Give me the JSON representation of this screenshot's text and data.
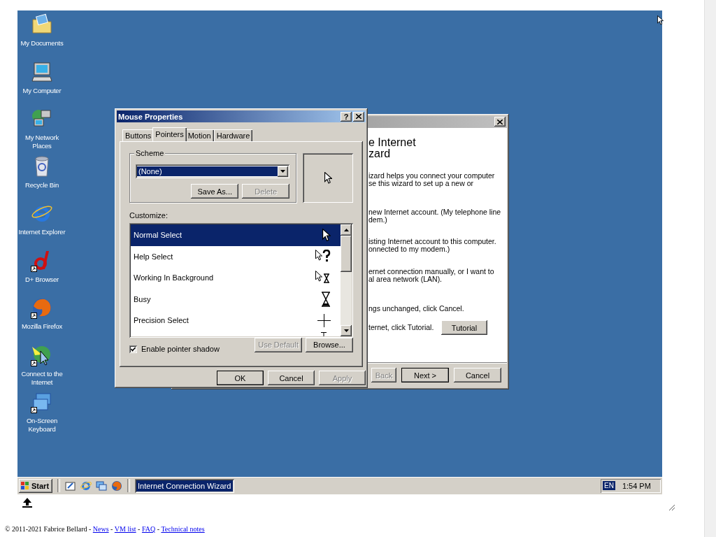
{
  "desktop": {
    "icons": [
      {
        "label": "My Documents",
        "kind": "documents",
        "shortcut": false
      },
      {
        "label": "My Computer",
        "kind": "computer",
        "shortcut": false
      },
      {
        "label": "My Network Places",
        "kind": "network",
        "shortcut": false
      },
      {
        "label": "Recycle Bin",
        "kind": "recycle",
        "shortcut": false
      },
      {
        "label": "Internet Explorer",
        "kind": "ie",
        "shortcut": false
      },
      {
        "label": "D+ Browser",
        "kind": "dplus",
        "shortcut": true
      },
      {
        "label": "Mozilla Firefox",
        "kind": "firefox",
        "shortcut": true
      },
      {
        "label": "Connect to the Internet",
        "kind": "connect",
        "shortcut": true
      },
      {
        "label": "On-Screen Keyboard",
        "kind": "keyboard",
        "shortcut": true
      }
    ]
  },
  "wizard": {
    "heading_lines": [
      "e Internet",
      "zard"
    ],
    "paragraphs": [
      [
        "izard helps you connect your computer",
        "se this wizard to set up a new or"
      ],
      [
        "new Internet account. (My telephone line",
        "dem.)"
      ],
      [
        "isting Internet account to this computer.",
        "onnected to my modem.)"
      ],
      [
        "ernet connection manually, or I want to",
        "al area network (LAN)."
      ],
      [
        "ngs unchanged, click Cancel."
      ]
    ],
    "tutorial_text": "ternet, click Tutorial.",
    "tutorial_button": "Tutorial",
    "buttons": [
      {
        "label": "Back",
        "disabled": true,
        "default": false
      },
      {
        "label": "Next >",
        "disabled": false,
        "default": true
      },
      {
        "label": "Cancel",
        "disabled": false,
        "default": false
      }
    ]
  },
  "mouse_properties": {
    "title": "Mouse Properties",
    "help_button": "?",
    "tabs": [
      {
        "label": "Buttons",
        "selected": false
      },
      {
        "label": "Pointers",
        "selected": true
      },
      {
        "label": "Motion",
        "selected": false
      },
      {
        "label": "Hardware",
        "selected": false
      }
    ],
    "scheme": {
      "label": "Scheme",
      "value": "(None)",
      "buttons": [
        {
          "label": "Save As...",
          "disabled": false
        },
        {
          "label": "Delete",
          "disabled": true
        }
      ]
    },
    "customize_label": "Customize:",
    "pointers": [
      {
        "label": "Normal Select",
        "kind": "normal",
        "selected": true
      },
      {
        "label": "Help Select",
        "kind": "help",
        "selected": false
      },
      {
        "label": "Working In Background",
        "kind": "working",
        "selected": false
      },
      {
        "label": "Busy",
        "kind": "busy",
        "selected": false
      },
      {
        "label": "Precision Select",
        "kind": "precision",
        "selected": false
      },
      {
        "kind": "text",
        "selected": false
      }
    ],
    "shadow": {
      "label": "Enable pointer shadow",
      "checked": true
    },
    "list_buttons": [
      {
        "label": "Use Default",
        "disabled": true
      },
      {
        "label": "Browse...",
        "disabled": false
      }
    ],
    "buttons": [
      {
        "label": "OK",
        "disabled": false,
        "default": true
      },
      {
        "label": "Cancel",
        "disabled": false,
        "default": false
      },
      {
        "label": "Apply",
        "disabled": true,
        "default": false
      }
    ]
  },
  "taskbar": {
    "start": "Start",
    "quick_launch": [
      {
        "kind": "desktop"
      },
      {
        "kind": "ie"
      },
      {
        "kind": "channels"
      },
      {
        "kind": "firefox"
      }
    ],
    "tasks": [
      {
        "label": "Internet Connection Wizard",
        "selected": true
      }
    ],
    "language": "EN",
    "clock": "1:54 PM"
  },
  "footer": {
    "text": "© 2011-2021 Fabrice Bellard",
    "separator": " - ",
    "links": [
      "News",
      "VM list",
      "FAQ",
      "Technical notes"
    ]
  }
}
